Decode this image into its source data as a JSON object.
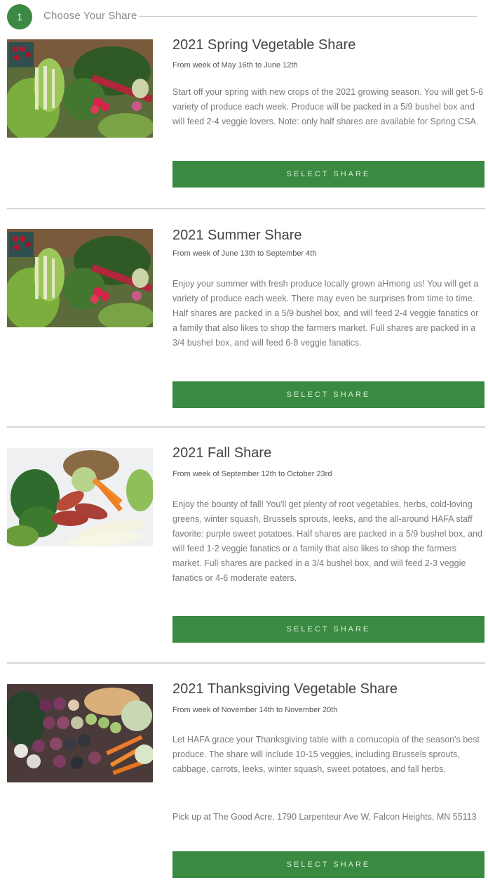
{
  "step": {
    "number": "1",
    "title": "Choose Your Share"
  },
  "shares": [
    {
      "title": "2021 Spring Vegetable Share",
      "dates": "From week of May 16th to June 12th",
      "description": "Start off your spring with new crops of the 2021 growing season. You will get 5-6 variety of produce each week. Produce will be packed in a 5/9 bushel box and will feed 2-4 veggie lovers. Note: only half shares are available for Spring CSA.",
      "button": "SELECT SHARE"
    },
    {
      "title": "2021 Summer Share",
      "dates": "From week of June 13th to September 4th",
      "description": "Enjoy your summer with fresh produce locally grown aHmong us! You will get a variety of produce each week. There may even be surprises from time to time. Half shares are packed in a 5/9 bushel box, and will feed 2-4 veggie fanatics or a family that also likes to shop the farmers market. Full shares are packed in a 3/4 bushel box, and will feed 6-8 veggie fanatics.",
      "button": "SELECT SHARE"
    },
    {
      "title": "2021 Fall Share",
      "dates": "From week of September 12th to October 23rd",
      "description": "Enjoy the bounty of fall! You'll get plenty of root vegetables, herbs, cold-loving greens, winter squash, Brussels sprouts, leeks, and the all-around HAFA staff favorite: purple sweet potatoes. Half shares are packed in a 5/9 bushel box, and will feed 1-2 veggie fanatics or a family that also likes to shop the farmers market. Full shares are packed in a 3/4 bushel box, and will feed 2-3 veggie fanatics or 4-6 moderate eaters.",
      "button": "SELECT SHARE"
    },
    {
      "title": "2021 Thanksgiving Vegetable Share",
      "dates": "From week of November 14th to November 20th",
      "description": "Let HAFA grace your Thanksgiving table with a cornucopia of the season's best produce. The share will include 10-15 veggies, including Brussels sprouts, cabbage, carrots, leeks, winter squash, sweet potatoes, and fall herbs.",
      "pickup": "Pick up at The Good Acre, 1790 Larpenteur Ave W, Falcon Heights, MN 55113",
      "button": "SELECT SHARE"
    }
  ],
  "colors": {
    "accent": "#3a8b41",
    "divider": "#d6d6d6",
    "text_muted": "#7a7a7a"
  }
}
